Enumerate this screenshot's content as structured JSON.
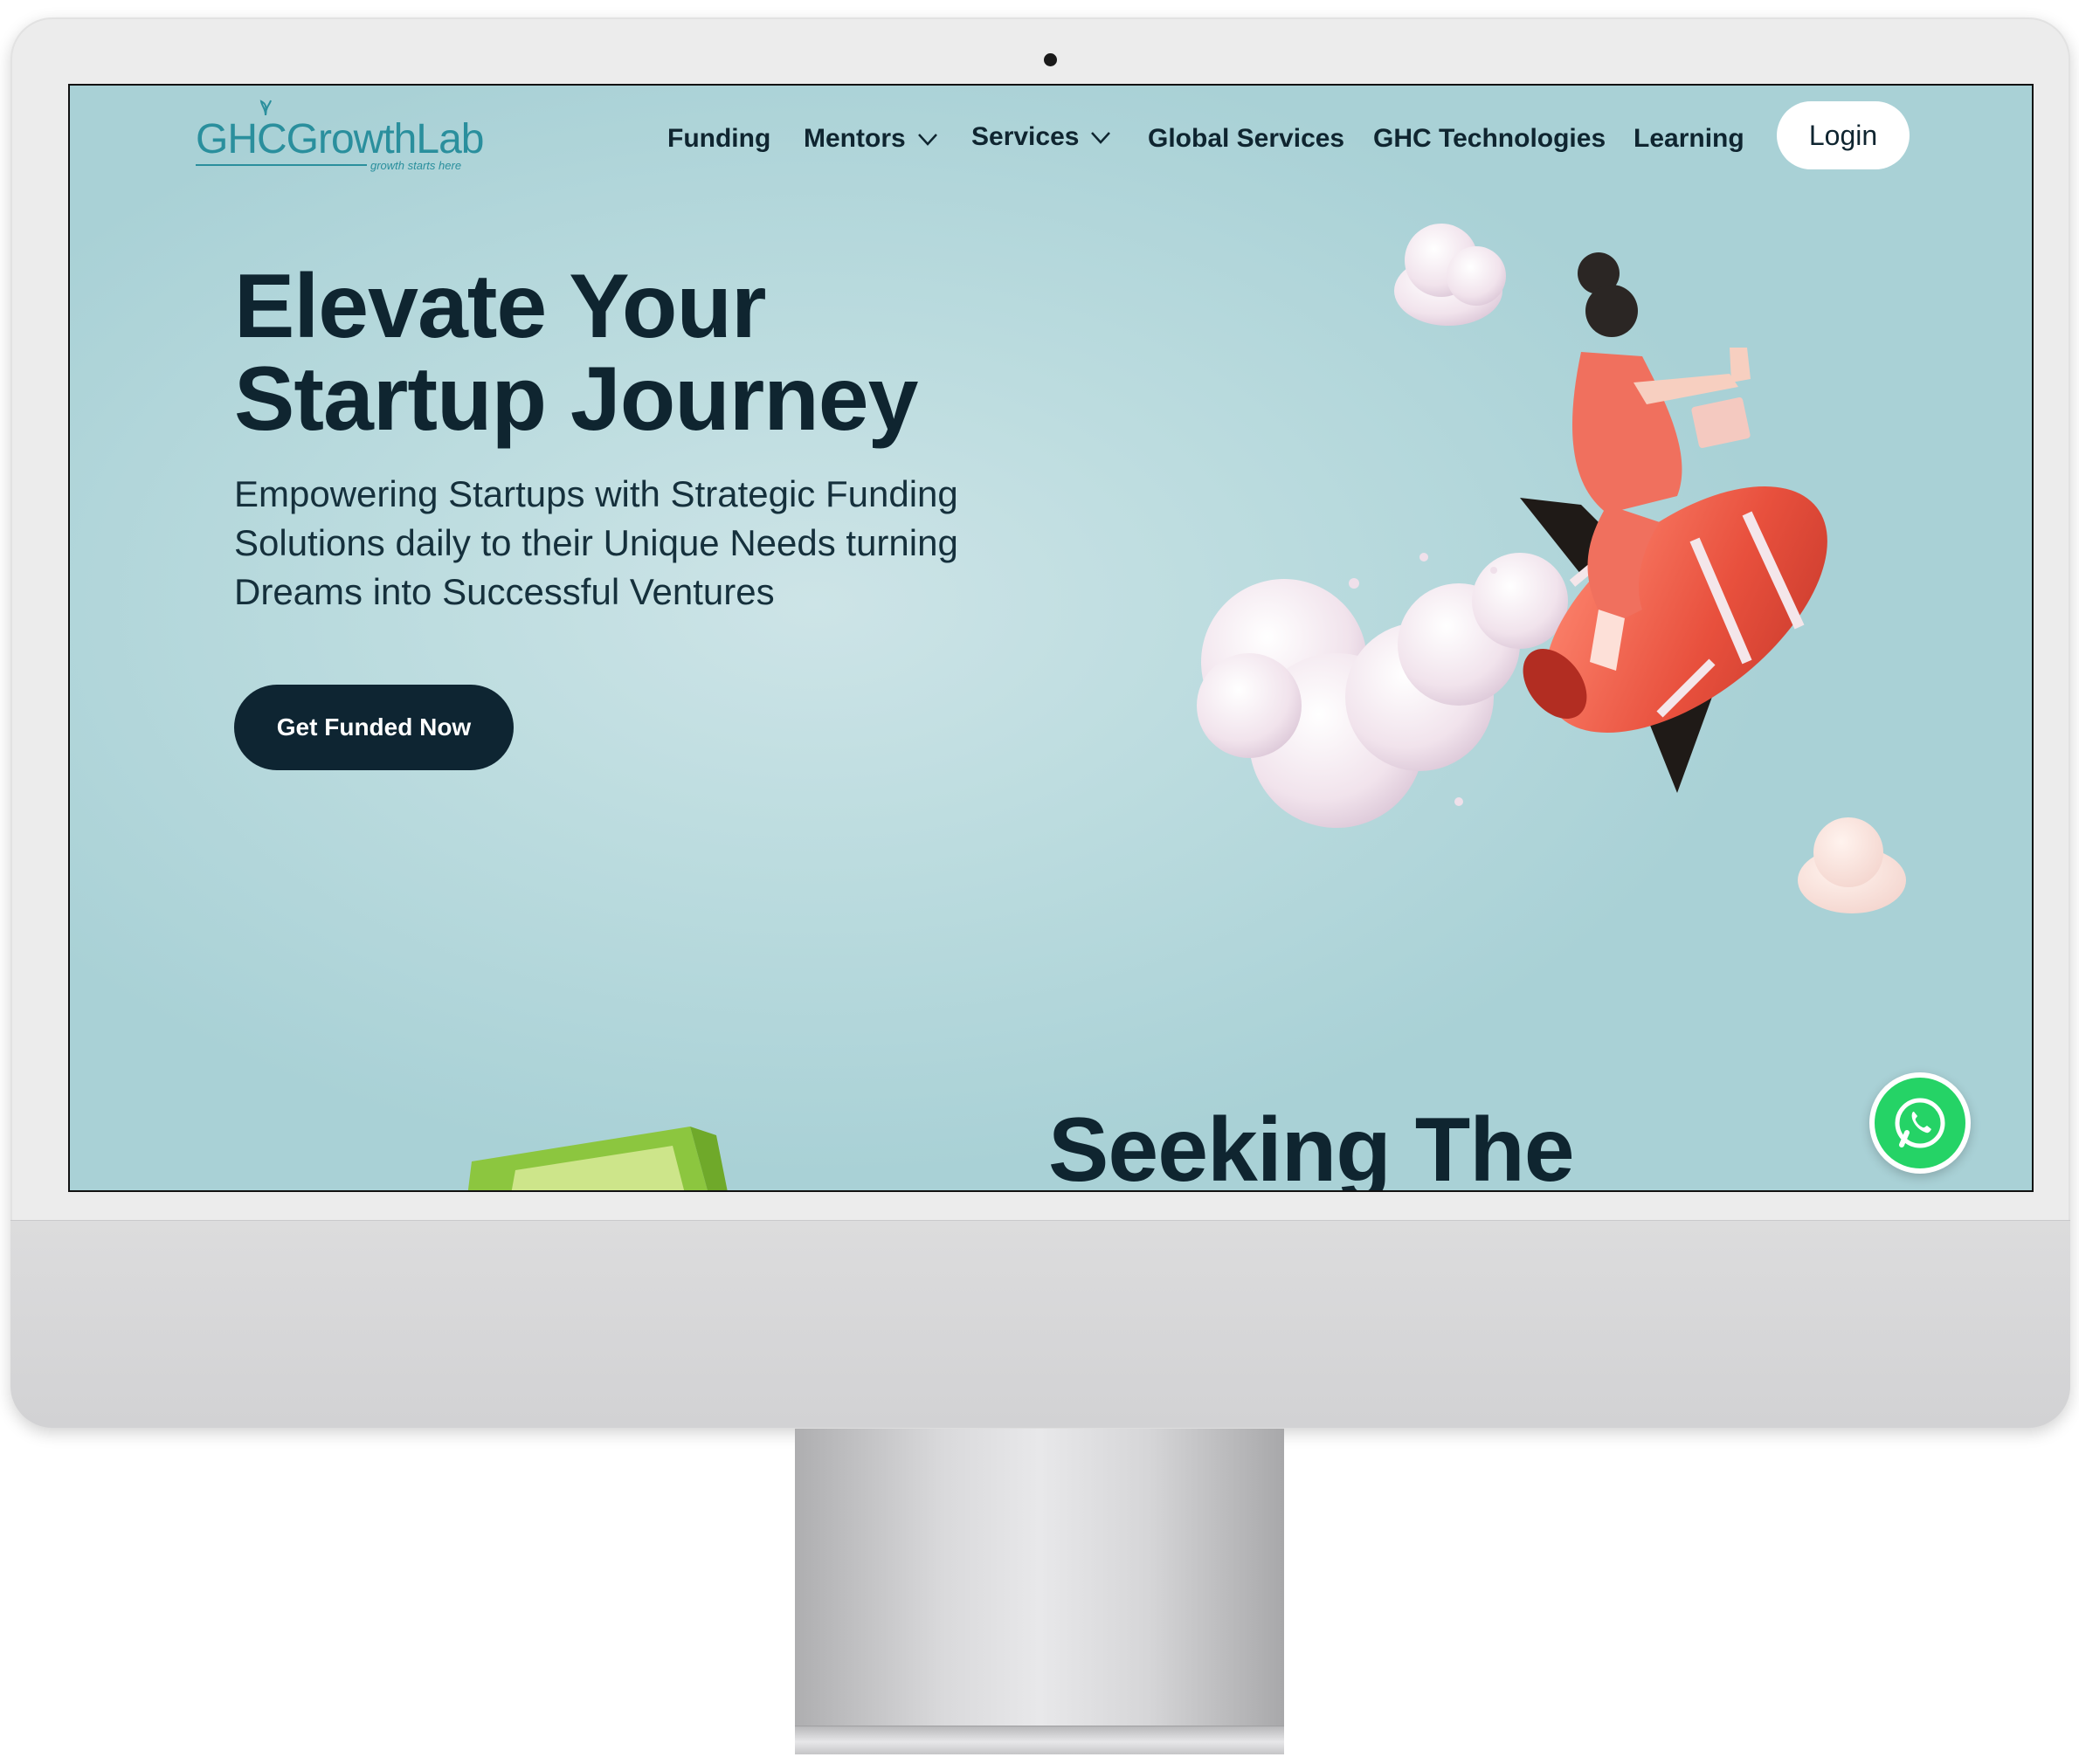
{
  "brand": {
    "logo_text": "GHCGrowthLab",
    "logo_tagline": "growth starts here",
    "color": "#2a8f9d"
  },
  "nav": {
    "items": [
      {
        "label": "Funding"
      },
      {
        "label": "Mentors",
        "has_dropdown": true
      },
      {
        "label": "Services",
        "has_dropdown": true
      },
      {
        "label": "Global Services"
      },
      {
        "label": "GHC Technologies"
      },
      {
        "label": "Learning"
      }
    ],
    "login_label": "Login"
  },
  "hero": {
    "title_line1": "Elevate Your",
    "title_line2": "Startup Journey",
    "subtitle": "Empowering Startups with Strategic Funding Solutions daily to their Unique Needs turning Dreams into Successful Ventures",
    "cta_label": "Get Funded Now"
  },
  "section2": {
    "title": "Seeking The"
  },
  "icons": {
    "whatsapp": "whatsapp-icon",
    "chevron": "chevron-down-icon",
    "illustration": "rocket-illustration"
  },
  "colors": {
    "dark_text": "#0f2530",
    "button_dark": "#0e2532",
    "whatsapp_green": "#25d366",
    "background_teal": "#b5d8dc"
  }
}
